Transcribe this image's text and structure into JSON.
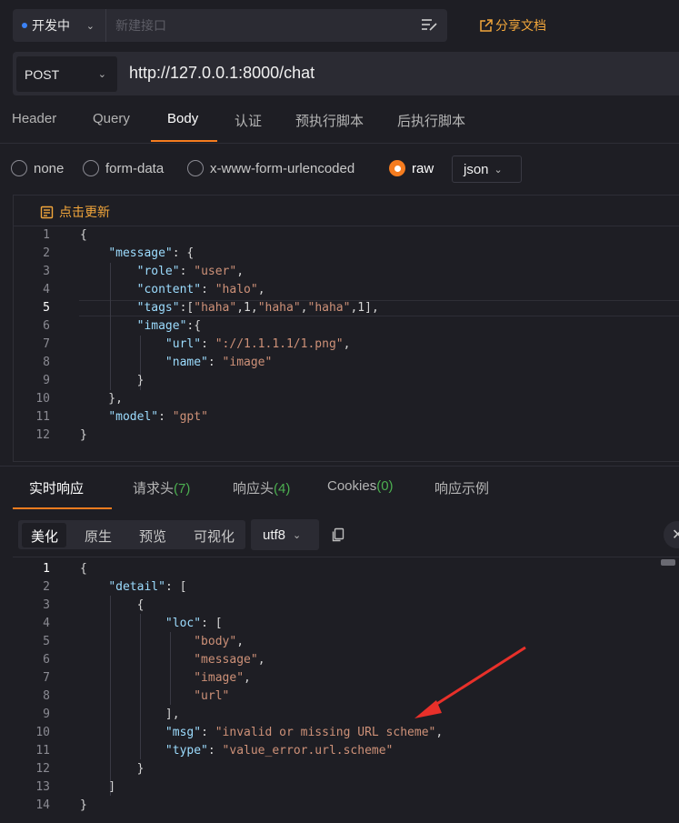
{
  "topbar": {
    "env_label": "开发中",
    "new_api_placeholder": "新建接口",
    "share_label": "分享文档"
  },
  "request": {
    "method": "POST",
    "url": "http://127.0.0.1:8000/chat"
  },
  "tabs": [
    "Header",
    "Query",
    "Body",
    "认证",
    "预执行脚本",
    "后执行脚本"
  ],
  "active_tab": "Body",
  "body_types": [
    "none",
    "form-data",
    "x-www-form-urlencoded",
    "raw"
  ],
  "selected_body_type": "raw",
  "raw_format": "json",
  "update_label": "点击更新",
  "request_lines": [
    "{",
    "    \"message\": {",
    "        \"role\": \"user\",",
    "        \"content\": \"halo\",",
    "        \"tags\":[\"haha\",1,\"haha\",\"haha\",1],",
    "        \"image\":{",
    "            \"url\": \"://1.1.1.1/1.png\",",
    "            \"name\": \"image\"",
    "        }",
    "    },",
    "    \"model\": \"gpt\"",
    "}"
  ],
  "response_tabs": {
    "live": "实时响应",
    "req_headers": "请求头",
    "req_headers_count": "(7)",
    "resp_headers": "响应头",
    "resp_headers_count": "(4)",
    "cookies": "Cookies",
    "cookies_count": "(0)",
    "example": "响应示例"
  },
  "format_buttons": [
    "美化",
    "原生",
    "预览",
    "可视化"
  ],
  "encoding": "utf8",
  "response_lines": [
    "{",
    "    \"detail\": [",
    "        {",
    "            \"loc\": [",
    "                \"body\",",
    "                \"message\",",
    "                \"image\",",
    "                \"url\"",
    "            ],",
    "            \"msg\": \"invalid or missing URL scheme\",",
    "            \"type\": \"value_error.url.scheme\"",
    "        }",
    "    ]",
    "}"
  ],
  "colors": {
    "accent": "#f57c1f",
    "background": "#1e1e24",
    "key": "#9cdcfe",
    "string": "#ce9178",
    "count_green": "#4caf50",
    "arrow": "#e8302a"
  }
}
